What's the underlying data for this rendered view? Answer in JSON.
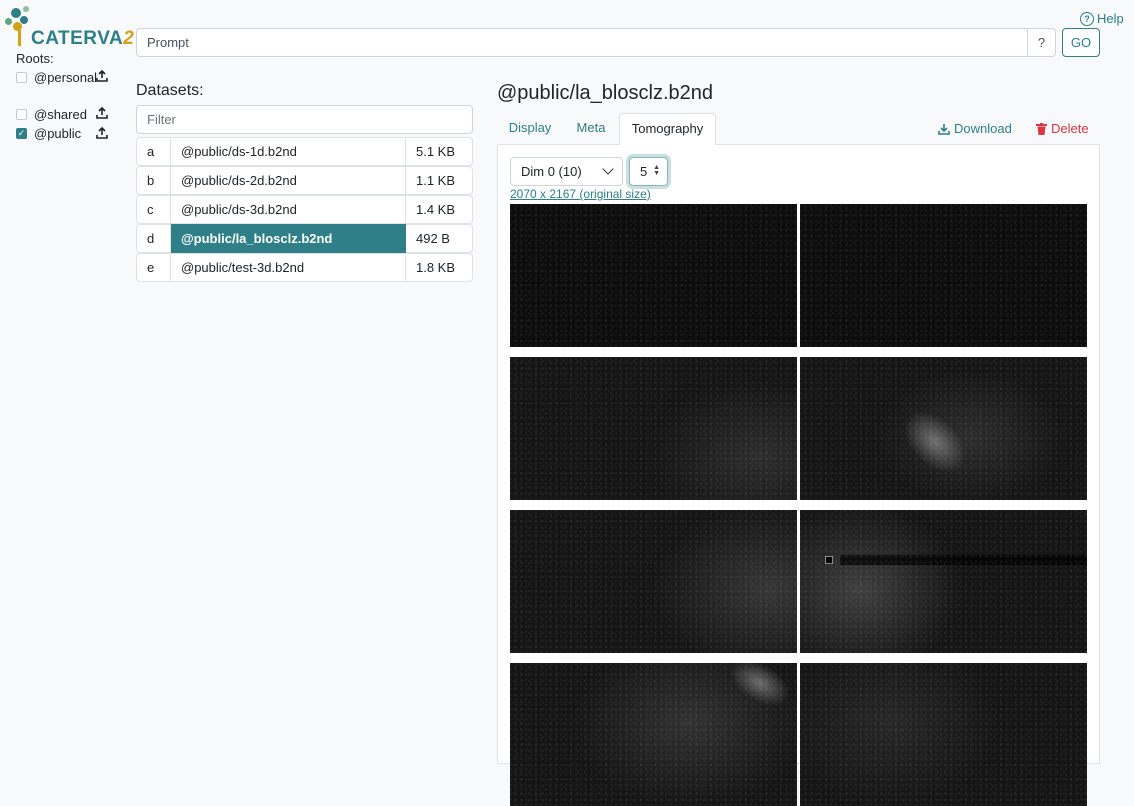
{
  "brand": {
    "name": "CATERVA",
    "suffix": "2",
    "accent": "#2e7f87"
  },
  "help": {
    "label": "Help",
    "icon": "question-circle-icon"
  },
  "search": {
    "placeholder": "Prompt",
    "help_button": "?",
    "go_button": "GO"
  },
  "roots": {
    "label": "Roots:",
    "items": [
      {
        "name": "@personal",
        "checked": false
      },
      {
        "name": "@shared",
        "checked": false
      },
      {
        "name": "@public",
        "checked": true
      }
    ]
  },
  "datasets": {
    "label": "Datasets:",
    "filter_placeholder": "Filter",
    "rows": [
      {
        "key": "a",
        "path": "@public/ds-1d.b2nd",
        "size": "5.1 KB",
        "active": false
      },
      {
        "key": "b",
        "path": "@public/ds-2d.b2nd",
        "size": "1.1 KB",
        "active": false
      },
      {
        "key": "c",
        "path": "@public/ds-3d.b2nd",
        "size": "1.4 KB",
        "active": false
      },
      {
        "key": "d",
        "path": "@public/la_blosclz.b2nd",
        "size": "492 B",
        "active": true
      },
      {
        "key": "e",
        "path": "@public/test-3d.b2nd",
        "size": "1.8 KB",
        "active": false
      }
    ]
  },
  "detail": {
    "title": "@public/la_blosclz.b2nd",
    "tabs": [
      {
        "label": "Display",
        "active": false
      },
      {
        "label": "Meta",
        "active": false
      },
      {
        "label": "Tomography",
        "active": true
      }
    ],
    "download_label": "Download",
    "delete_label": "Delete",
    "dim_select": "Dim 0 (10)",
    "slice_value": "5",
    "size_link": "2070 x 2167 (original size)"
  }
}
